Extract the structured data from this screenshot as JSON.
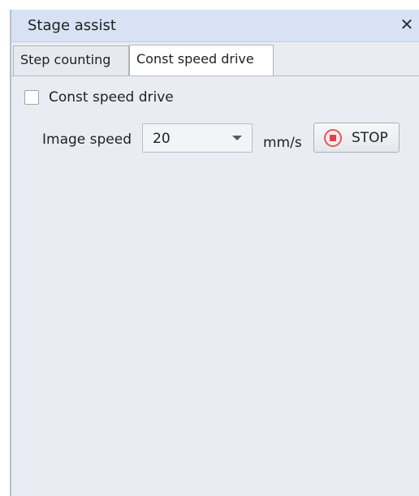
{
  "panel": {
    "title": "Stage assist",
    "close_glyph": "✕"
  },
  "tabs": [
    {
      "label": "Step counting",
      "selected": false
    },
    {
      "label": "Const speed drive",
      "selected": true
    }
  ],
  "const_speed": {
    "checkbox_label": "Const speed drive",
    "checkbox_checked": false,
    "image_speed_label": "Image speed",
    "image_speed_value": "20",
    "unit": "mm/s",
    "stop_label": "STOP"
  },
  "icons": {
    "close": "close-icon",
    "dropdown": "chevron-down-icon",
    "stop": "stop-icon"
  },
  "colors": {
    "titlebar": "#d7e3f5",
    "panel_bg": "#e9edf3",
    "stop_accent": "#d9444b"
  }
}
